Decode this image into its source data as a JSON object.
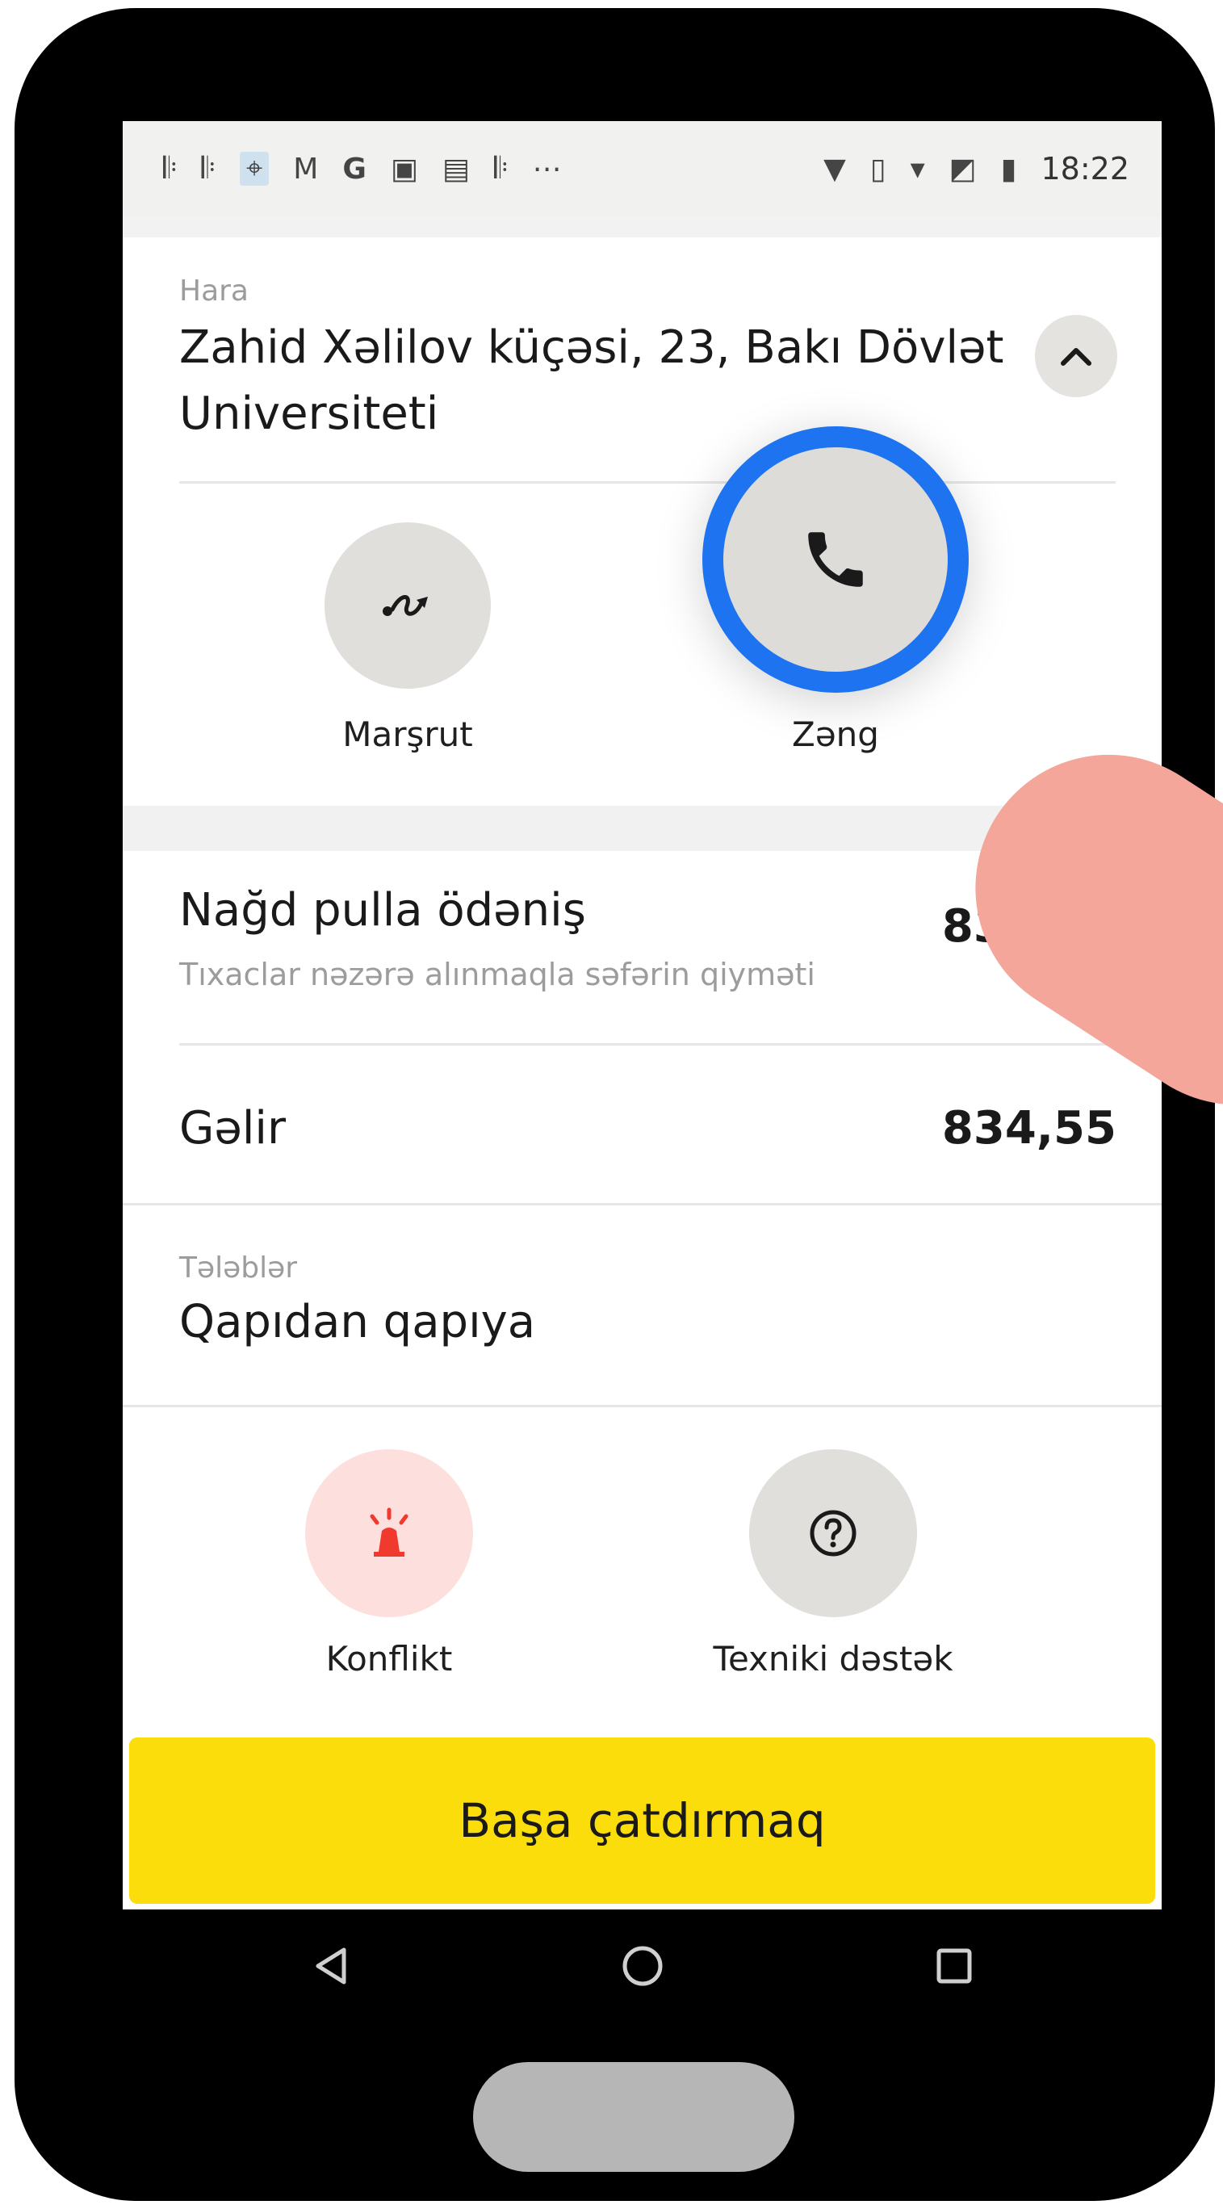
{
  "status_bar": {
    "time": "18:22",
    "icons": [
      "signal-icon",
      "signal-icon",
      "location-pin-icon",
      "gmail-icon",
      "google-icon",
      "image-icon",
      "photo-icon",
      "signal-icon",
      "more-icon",
      "location-icon",
      "vibrate-icon",
      "wifi-icon",
      "no-sim-icon",
      "battery-icon"
    ]
  },
  "destination": {
    "caption": "Hara",
    "address": "Zahid Xəlilov küçəsi, 23, Bakı Dövlət Universiteti"
  },
  "actions": {
    "route_label": "Marşrut",
    "call_label": "Zəng"
  },
  "payment": {
    "title": "Nağd pulla ödəniş",
    "subtitle": "Tıxaclar nəzərə alınmaqla səfərin qiyməti",
    "value": "834,55"
  },
  "income": {
    "title": "Gəlir",
    "value": "834,55"
  },
  "requirements": {
    "caption": "Tələblər",
    "value": "Qapıdan qapıya"
  },
  "bottom_actions": {
    "conflict_label": "Konflikt",
    "support_label": "Texniki dəstək"
  },
  "finish_button": {
    "label": "Başa çatdırmaq"
  },
  "colors": {
    "accent_yellow": "#fbdd0b",
    "highlight_blue": "#1e74f0",
    "conflict_red": "#f03a2e",
    "conflict_bg": "#fde0de"
  }
}
